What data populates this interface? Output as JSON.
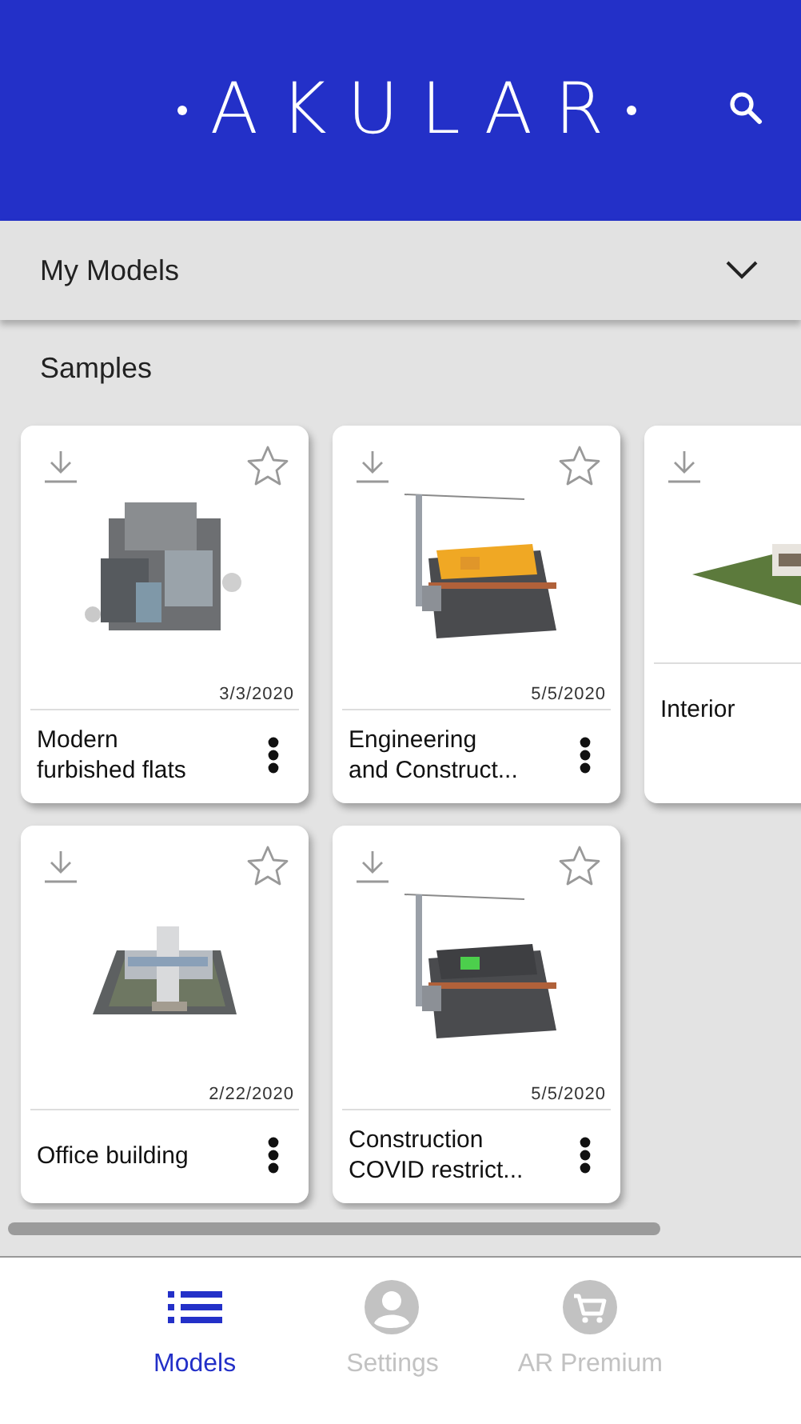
{
  "header": {
    "logo": "AKULAR"
  },
  "dropdown": {
    "label": "My Models",
    "expanded": false
  },
  "section": {
    "title": "Samples"
  },
  "models": [
    {
      "title": "Modern\nfurbished flats",
      "date": "3/3/2020"
    },
    {
      "title": "Office building",
      "date": "2/22/2020"
    },
    {
      "title": "Engineering\nand Construct...",
      "date": "5/5/2020"
    },
    {
      "title": "Construction\nCOVID restrict...",
      "date": "5/5/2020"
    },
    {
      "title": "Interior"
    }
  ],
  "nav": [
    {
      "label": "Models",
      "kind": "list",
      "selected": true
    },
    {
      "label": "Settings",
      "kind": "profile",
      "selected": false
    },
    {
      "label": "AR Premium",
      "kind": "shop",
      "selected": false
    }
  ]
}
